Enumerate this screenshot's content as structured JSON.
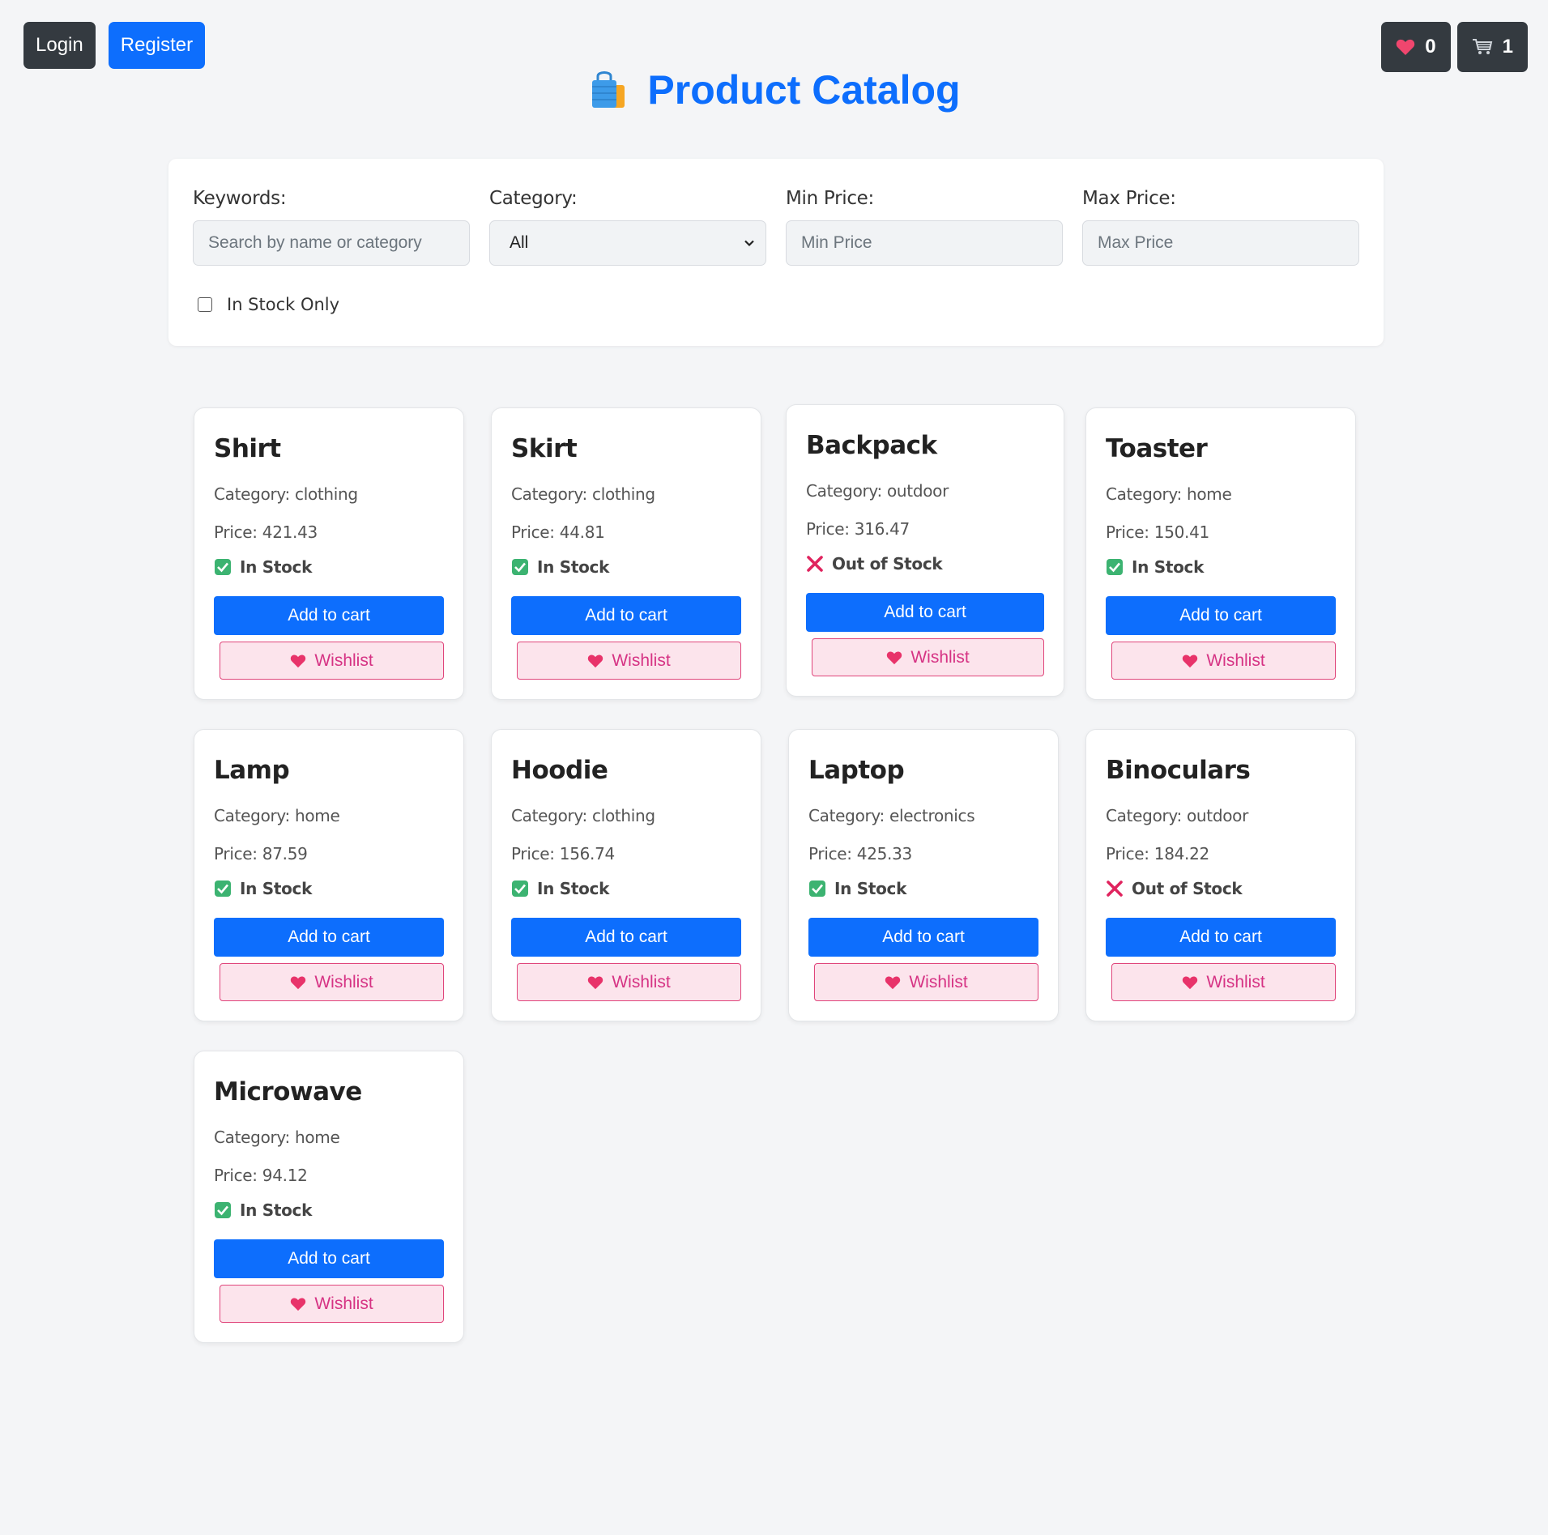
{
  "auth": {
    "login_label": "Login",
    "register_label": "Register"
  },
  "counters": {
    "wishlist_count": "0",
    "cart_count": "1"
  },
  "header": {
    "title": "Product Catalog"
  },
  "filters": {
    "keywords_label": "Keywords:",
    "keywords_placeholder": "Search by name or category",
    "category_label": "Category:",
    "category_value": "All",
    "min_price_label": "Min Price:",
    "min_price_placeholder": "Min Price",
    "max_price_label": "Max Price:",
    "max_price_placeholder": "Max Price",
    "in_stock_label": "In Stock Only",
    "in_stock_checked": false
  },
  "labels": {
    "add_to_cart": "Add to cart",
    "wishlist": "Wishlist"
  },
  "products": [
    {
      "name": "Shirt",
      "category": "Category: clothing",
      "price": "Price: 421.43",
      "stock": "In Stock",
      "in_stock": true
    },
    {
      "name": "Skirt",
      "category": "Category: clothing",
      "price": "Price: 44.81",
      "stock": "In Stock",
      "in_stock": true
    },
    {
      "name": "Backpack",
      "category": "Category: outdoor",
      "price": "Price: 316.47",
      "stock": "Out of Stock",
      "in_stock": false
    },
    {
      "name": "Toaster",
      "category": "Category: home",
      "price": "Price: 150.41",
      "stock": "In Stock",
      "in_stock": true
    },
    {
      "name": "Lamp",
      "category": "Category: home",
      "price": "Price: 87.59",
      "stock": "In Stock",
      "in_stock": true
    },
    {
      "name": "Hoodie",
      "category": "Category: clothing",
      "price": "Price: 156.74",
      "stock": "In Stock",
      "in_stock": true
    },
    {
      "name": "Laptop",
      "category": "Category: electronics",
      "price": "Price: 425.33",
      "stock": "In Stock",
      "in_stock": true
    },
    {
      "name": "Binoculars",
      "category": "Category: outdoor",
      "price": "Price: 184.22",
      "stock": "Out of Stock",
      "in_stock": false
    },
    {
      "name": "Microwave",
      "category": "Category: home",
      "price": "Price: 94.12",
      "stock": "In Stock",
      "in_stock": true
    }
  ],
  "colors": {
    "primary": "#0d6efd",
    "dark": "#343a40",
    "wishlist_pink": "#d63384",
    "in_stock_green": "#3cb371",
    "out_of_stock_red": "#e0245e"
  }
}
